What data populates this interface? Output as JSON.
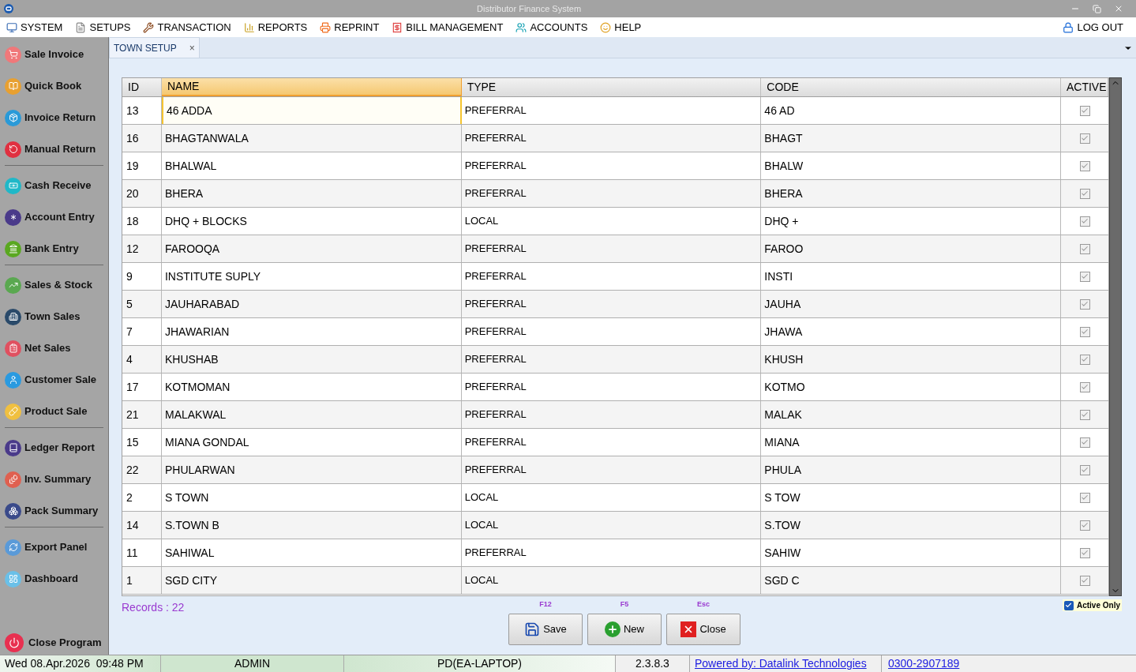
{
  "window": {
    "title": "Distributor Finance System"
  },
  "menu": [
    {
      "label": "SYSTEM"
    },
    {
      "label": "SETUPS"
    },
    {
      "label": "TRANSACTION"
    },
    {
      "label": "REPORTS"
    },
    {
      "label": "REPRINT"
    },
    {
      "label": "BILL MANAGEMENT"
    },
    {
      "label": "ACCOUNTS"
    },
    {
      "label": "HELP"
    }
  ],
  "logout": "LOG OUT",
  "sidebar": {
    "groups": [
      {
        "items": [
          "Sale Invoice",
          "Quick Book",
          "Invoice Return",
          "Manual Return"
        ]
      },
      {
        "items": [
          "Cash Receive",
          "Account Entry",
          "Bank Entry"
        ]
      },
      {
        "items": [
          "Sales & Stock",
          "Town Sales",
          "Net Sales",
          "Customer Sale",
          "Product Sale"
        ]
      },
      {
        "items": [
          "Ledger Report",
          "Inv. Summary",
          "Pack Summary"
        ]
      },
      {
        "items": [
          "Export Panel",
          "Dashboard"
        ]
      }
    ],
    "close": "Close Program"
  },
  "tabs": [
    {
      "label": "TOWN SETUP",
      "selected": true,
      "close": "×"
    }
  ],
  "table": {
    "columns": [
      {
        "label": "ID",
        "selected": false
      },
      {
        "label": "NAME",
        "selected": true
      },
      {
        "label": "TYPE",
        "selected": false
      },
      {
        "label": "CODE",
        "selected": false
      },
      {
        "label": "ACTIVE",
        "selected": false
      }
    ],
    "rows": [
      {
        "id": "13",
        "name": "46 ADDA",
        "type": "PREFERRAL",
        "code": "46 AD",
        "active": true,
        "selected": true
      },
      {
        "id": "16",
        "name": "BHAGTANWALA",
        "type": "PREFERRAL",
        "code": "BHAGT",
        "active": true,
        "selected": false
      },
      {
        "id": "19",
        "name": "BHALWAL",
        "type": "PREFERRAL",
        "code": "BHALW",
        "active": true,
        "selected": false
      },
      {
        "id": "20",
        "name": "BHERA",
        "type": "PREFERRAL",
        "code": "BHERA",
        "active": true,
        "selected": false
      },
      {
        "id": "18",
        "name": "DHQ + BLOCKS",
        "type": "LOCAL",
        "code": "DHQ +",
        "active": true,
        "selected": false
      },
      {
        "id": "12",
        "name": "FAROOQA",
        "type": "PREFERRAL",
        "code": "FAROO",
        "active": true,
        "selected": false
      },
      {
        "id": "9",
        "name": "INSTITUTE SUPLY",
        "type": "PREFERRAL",
        "code": "INSTI",
        "active": true,
        "selected": false
      },
      {
        "id": "5",
        "name": "JAUHARABAD",
        "type": "PREFERRAL",
        "code": "JAUHA",
        "active": true,
        "selected": false
      },
      {
        "id": "7",
        "name": "JHAWARIAN",
        "type": "PREFERRAL",
        "code": "JHAWA",
        "active": true,
        "selected": false
      },
      {
        "id": "4",
        "name": "KHUSHAB",
        "type": "PREFERRAL",
        "code": "KHUSH",
        "active": true,
        "selected": false
      },
      {
        "id": "17",
        "name": "KOTMOMAN",
        "type": "PREFERRAL",
        "code": "KOTMO",
        "active": true,
        "selected": false
      },
      {
        "id": "21",
        "name": "MALAKWAL",
        "type": "PREFERRAL",
        "code": "MALAK",
        "active": true,
        "selected": false
      },
      {
        "id": "15",
        "name": "MIANA GONDAL",
        "type": "PREFERRAL",
        "code": "MIANA",
        "active": true,
        "selected": false
      },
      {
        "id": "22",
        "name": "PHULARWAN",
        "type": "PREFERRAL",
        "code": "PHULA",
        "active": true,
        "selected": false
      },
      {
        "id": "2",
        "name": "S TOWN",
        "type": "LOCAL",
        "code": "S TOW",
        "active": true,
        "selected": false
      },
      {
        "id": "14",
        "name": "S.TOWN B",
        "type": "LOCAL",
        "code": "S.TOW",
        "active": true,
        "selected": false
      },
      {
        "id": "11",
        "name": "SAHIWAL",
        "type": "PREFERRAL",
        "code": "SAHIW",
        "active": true,
        "selected": false
      },
      {
        "id": "1",
        "name": "SGD CITY",
        "type": "LOCAL",
        "code": "SGD C",
        "active": true,
        "selected": false
      }
    ]
  },
  "records": "Records : 22",
  "buttons": [
    {
      "key": "F12",
      "label": "Save",
      "kind": "save"
    },
    {
      "key": "F5",
      "label": "New",
      "kind": "new"
    },
    {
      "key": "Esc",
      "label": "Close",
      "kind": "close"
    }
  ],
  "active_only": {
    "label": "Active Only",
    "checked": true
  },
  "status_bar": {
    "datetime": "Wed 08.Apr.2026  09:48 PM",
    "user": "ADMIN",
    "machine": "PD(EA-LAPTOP)",
    "version": "2.3.8.3",
    "powered": "Powered by: Datalink Technologies",
    "phone": "0300-2907189"
  }
}
